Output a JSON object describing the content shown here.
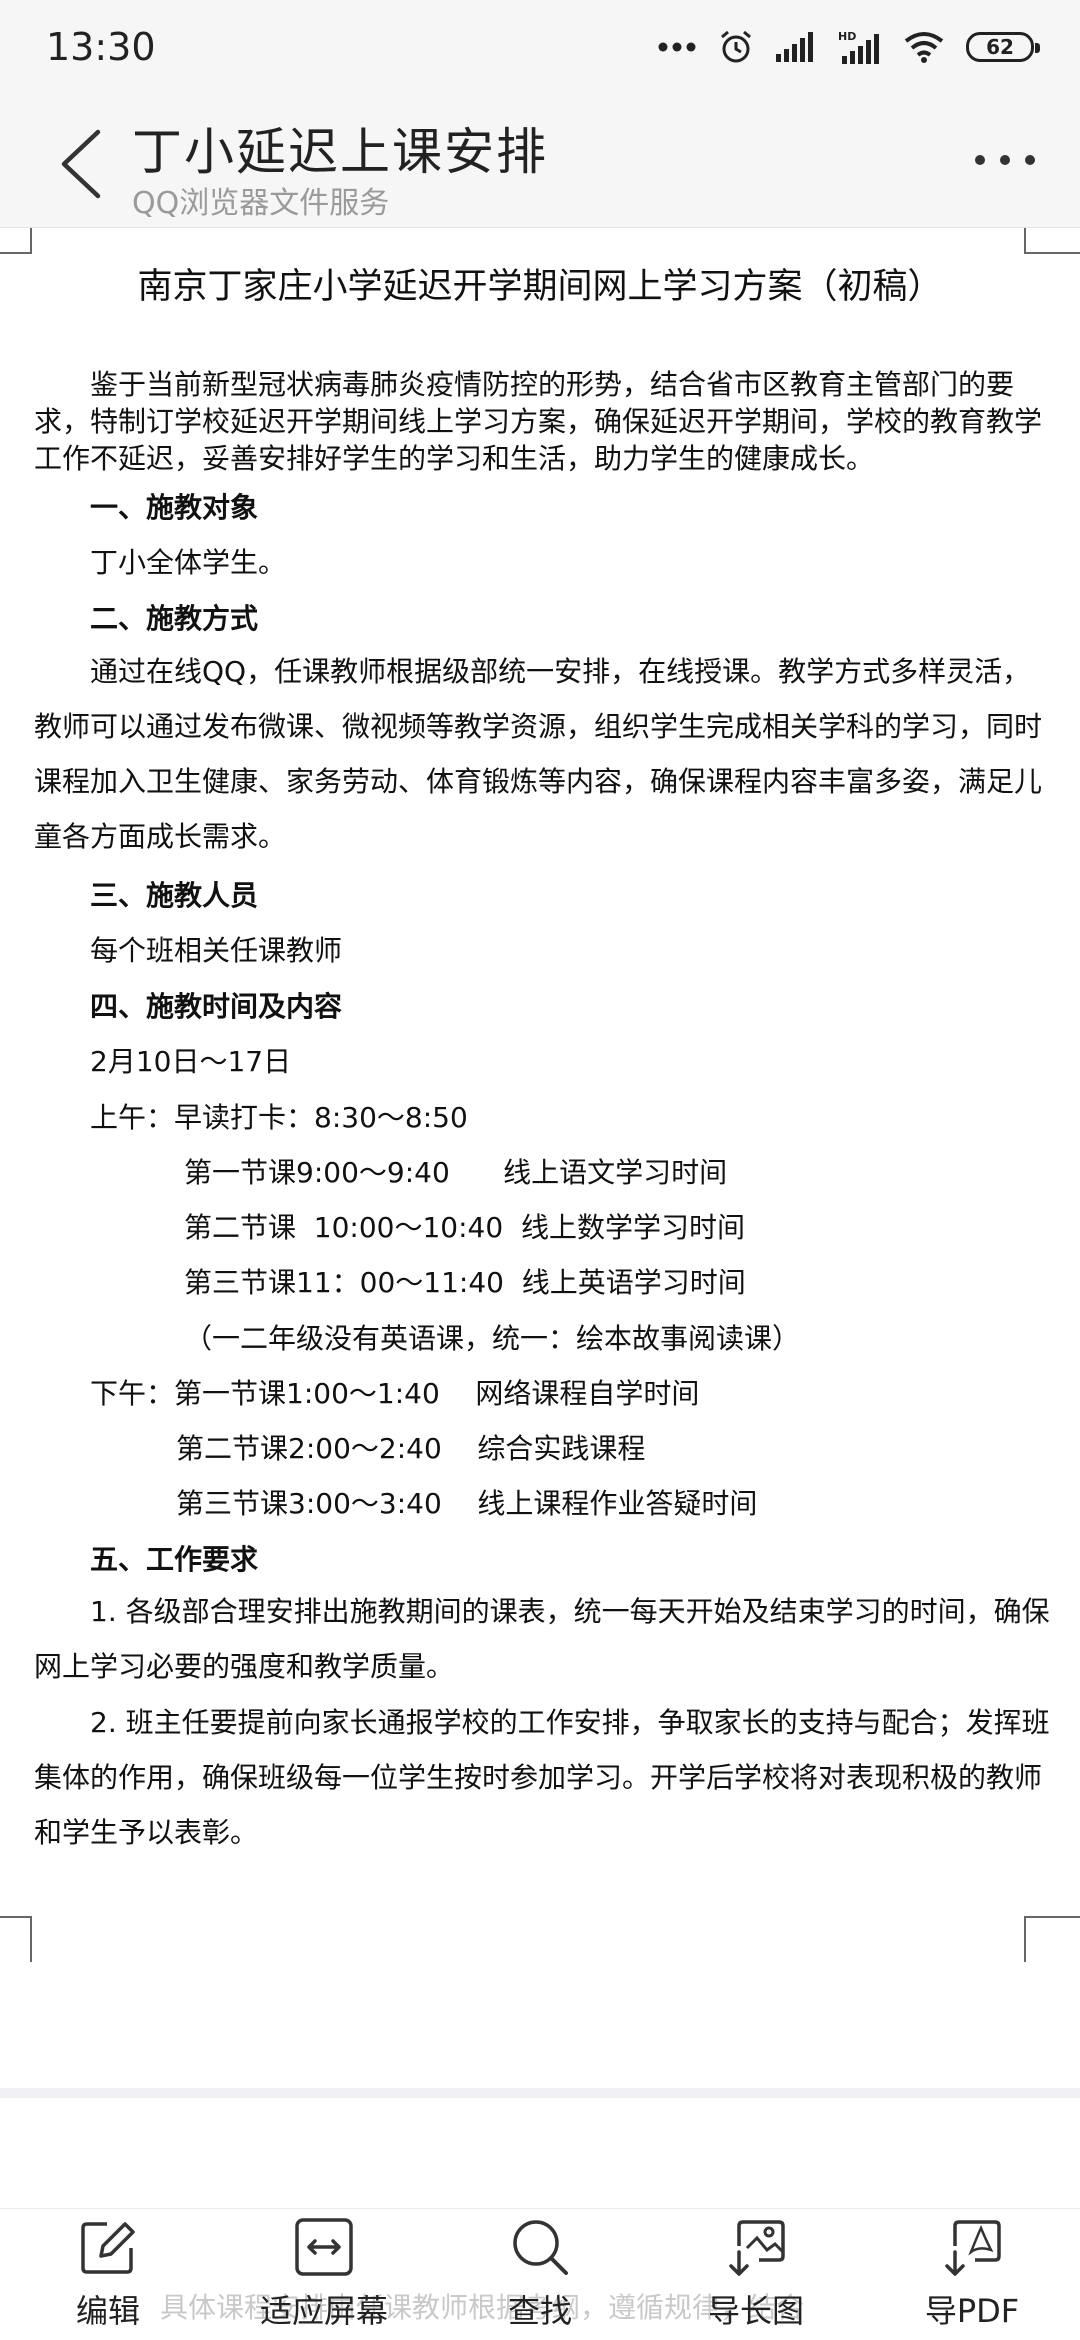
{
  "status_bar": {
    "time": "13:30",
    "icons": [
      "more-dots-icon",
      "alarm-icon",
      "signal-icon",
      "hd-signal-icon",
      "wifi-icon"
    ],
    "hd_label": "HD",
    "battery": "62"
  },
  "title_bar": {
    "title": "丁小延迟上课安排",
    "subtitle": "QQ浏览器文件服务"
  },
  "document": {
    "title": "南京丁家庄小学延迟开学期间网上学习方案（初稿）",
    "intro": "鉴于当前新型冠状病毒肺炎疫情防控的形势，结合省市区教育主管部门的要求，特制订学校延迟开学期间线上学习方案，确保延迟开学期间，学校的教育教学工作不延迟，妥善安排好学生的学习和生活，助力学生的健康成长。",
    "section1_heading": "一、施教对象",
    "section1_text": "丁小全体学生。",
    "section2_heading": "二、施教方式",
    "section2_text": "通过在线QQ，任课教师根据级部统一安排，在线授课。教学方式多样灵活，教师可以通过发布微课、微视频等教学资源，组织学生完成相关学科的学习，同时课程加入卫生健康、家务劳动、体育锻炼等内容，确保课程内容丰富多姿，满足儿童各方面成长需求。",
    "section3_heading": "三、施教人员",
    "section3_text": "每个班相关任课教师",
    "section4_heading": "四、施教时间及内容",
    "date_range": "2月10日～17日",
    "morning_checkin": "上午：早读打卡：8:30～8:50",
    "am_class1": "第一节课9:00～9:40      线上语文学习时间",
    "am_class2": "第二节课  10:00～10:40  线上数学学习时间",
    "am_class3": "第三节课11：00～11:40  线上英语学习时间",
    "am_note": "（一二年级没有英语课，统一：绘本故事阅读课）",
    "pm_class1": "下午：第一节课1:00～1:40    网络课程自学时间",
    "pm_class2": "第二节课2:00～2:40    综合实践课程",
    "pm_class3": "第三节课3:00～3:40    线上课程作业答疑时间",
    "section5_heading": "五、工作要求",
    "req1": "1. 各级部合理安排出施教期间的课表，统一每天开始及结束学习的时间，确保网上学习必要的强度和教学质量。",
    "req2": "2. 班主任要提前向家长通报学校的工作安排，争取家长的支持与配合；发挥班集体的作用，确保班级每一位学生按时参加学习。开学后学校将对表现积极的教师和学生予以表彰。",
    "next_page_ghost": "具体课程安排由任课教师根据考纲，遵循规律，结合"
  },
  "toolbar": {
    "edit": "编辑",
    "fit_screen": "适应屏幕",
    "find": "查找",
    "export_image": "导长图",
    "export_pdf": "导PDF"
  }
}
